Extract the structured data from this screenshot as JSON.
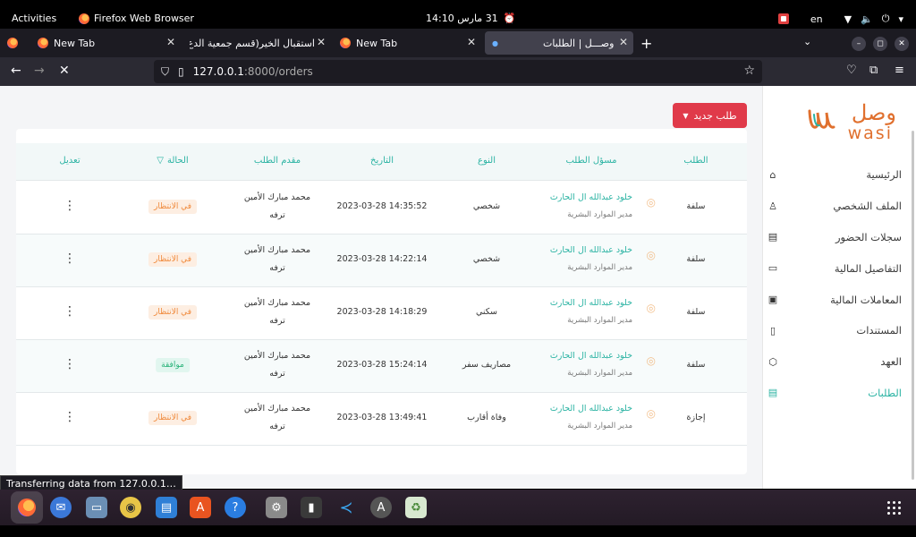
{
  "topbar": {
    "activities": "Activities",
    "app_name": "Firefox Web Browser",
    "clock": "31 مارس 14:10",
    "language": "en"
  },
  "tabs": [
    {
      "title": "New Tab"
    },
    {
      "title": "استقبال الخير(قسم جمعية الدع"
    },
    {
      "title": "New Tab"
    },
    {
      "title": "وصـــل | الطلبات"
    }
  ],
  "url": {
    "prefix": "127.0.0.1",
    "rest": ":8000/orders"
  },
  "logo": {
    "ar": "وصل",
    "en": "wasi"
  },
  "sidebar": [
    {
      "label": "الرئيسية",
      "icon": "home-icon"
    },
    {
      "label": "الملف الشخصي",
      "icon": "user-icon"
    },
    {
      "label": "سجلات الحضور",
      "icon": "calendar-icon"
    },
    {
      "label": "التفاصيل المالية",
      "icon": "card-icon"
    },
    {
      "label": "المعاملات المالية",
      "icon": "money-icon"
    },
    {
      "label": "المستندات",
      "icon": "document-icon"
    },
    {
      "label": "العهد",
      "icon": "box-icon"
    },
    {
      "label": "الطلبات",
      "icon": "orders-icon",
      "active": true
    }
  ],
  "new_order_button": "طلب جديد",
  "table": {
    "headers": {
      "request": "الطلب",
      "owner": "مسؤل الطلب",
      "type": "النوع",
      "date": "التاريخ",
      "applicant": "مقدم الطلب",
      "status": "الحالة",
      "edit": "تعديل"
    },
    "rows": [
      {
        "request": "سلفة",
        "owner_name": "خلود عبدالله ال الحارث",
        "owner_role": "مدير الموارد البشرية",
        "type": "شخصي",
        "date": "2023-03-28 14:35:52",
        "applicant_line1": "محمد مبارك الأمين",
        "applicant_line2": "ترفه",
        "status": "في الانتظار",
        "status_kind": "wait"
      },
      {
        "request": "سلفة",
        "owner_name": "خلود عبدالله ال الحارث",
        "owner_role": "مدير الموارد البشرية",
        "type": "شخصي",
        "date": "2023-03-28 14:22:14",
        "applicant_line1": "محمد مبارك الأمين",
        "applicant_line2": "ترفه",
        "status": "في الانتظار",
        "status_kind": "wait"
      },
      {
        "request": "سلفة",
        "owner_name": "خلود عبدالله ال الحارث",
        "owner_role": "مدير الموارد البشرية",
        "type": "سكني",
        "date": "2023-03-28 14:18:29",
        "applicant_line1": "محمد مبارك الأمين",
        "applicant_line2": "ترفه",
        "status": "في الانتظار",
        "status_kind": "wait"
      },
      {
        "request": "سلفة",
        "owner_name": "خلود عبدالله ال الحارث",
        "owner_role": "مدير الموارد البشرية",
        "type": "مصاريف سفر",
        "date": "2023-03-28 15:24:14",
        "applicant_line1": "محمد مبارك الأمين",
        "applicant_line2": "ترفه",
        "status": "موافقة",
        "status_kind": "ok"
      },
      {
        "request": "إجازة",
        "owner_name": "خلود عبدالله ال الحارث",
        "owner_role": "مدير الموارد البشرية",
        "type": "وفاة أقارب",
        "date": "2023-03-28 13:49:41",
        "applicant_line1": "محمد مبارك الأمين",
        "applicant_line2": "ترفه",
        "status": "في الانتظار",
        "status_kind": "wait"
      }
    ]
  },
  "status_bar": "Transferring data from 127.0.0.1…",
  "colors": {
    "accent": "#2bb3a3",
    "danger": "#e03a4a",
    "brand": "#e0702e",
    "wait": "#f08a3c",
    "ok": "#2bb37a"
  }
}
